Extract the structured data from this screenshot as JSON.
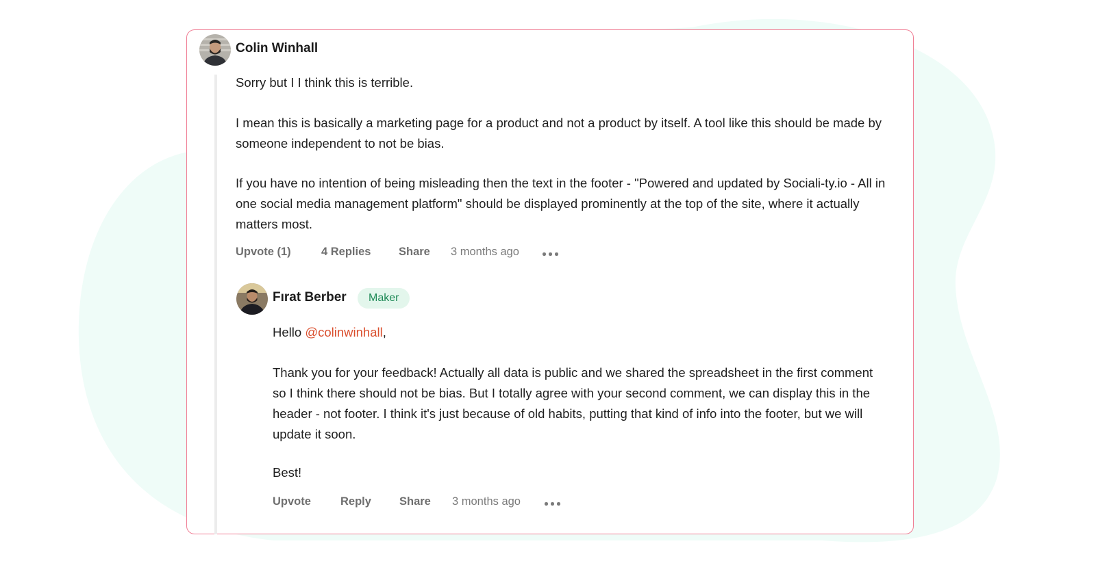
{
  "thread": {
    "comment": {
      "author": "Colin Winhall",
      "paragraphs": [
        "Sorry but I I think this is terrible.",
        "I mean this is basically a marketing page for a product and not a product by itself. A tool like this should be made by someone independent to not be bias.",
        "If you have no intention of being misleading then the text in the footer - \"Powered and updated by Sociali-ty.io - All in one social media management platform\" should be displayed prominently at the top of the site, where it actually matters most."
      ],
      "actions": {
        "upvote": "Upvote (1)",
        "replies": "4 Replies",
        "share": "Share",
        "time": "3 months ago"
      }
    },
    "reply": {
      "author": "Fırat Berber",
      "badge": "Maker",
      "greeting": "Hello",
      "mention": "@colinwinhall",
      "greeting_end": ",",
      "paragraphs": [
        "Thank you for your feedback! Actually all data is public and we shared the spreadsheet in the first comment so I think there should not be bias. But I totally agree with your second comment, we can display this in the header - not footer. I think it's just because of old habits, putting that kind of info into the footer, but we will update it soon.",
        "Best!"
      ],
      "actions": {
        "upvote": "Upvote",
        "reply": "Reply",
        "share": "Share",
        "time": "3 months ago"
      }
    }
  },
  "colors": {
    "card_border": "#f07f95",
    "background_blob": "#effcf8",
    "mention": "#da4f2e",
    "maker_badge_bg": "#e3f6ec",
    "maker_badge_text": "#1f8a57"
  }
}
